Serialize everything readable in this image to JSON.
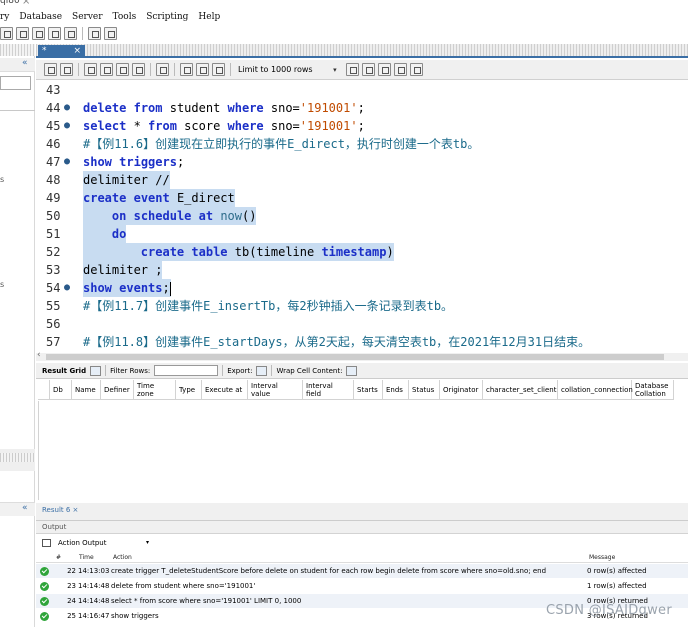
{
  "window": {
    "title_fragment": "ql80",
    "close_glyph": "×"
  },
  "menu": [
    "ry",
    "Database",
    "Server",
    "Tools",
    "Scripting",
    "Help"
  ],
  "editor_tab": {
    "label": "*",
    "close_glyph": "×"
  },
  "editor_toolbar": {
    "limit_label": "Limit to 1000 rows",
    "limit_dropdown": "▾"
  },
  "left_panel": {
    "chevron": "«",
    "tick_s": "s",
    "chevron_bottom": "«"
  },
  "code_lines": [
    {
      "n": "43",
      "dot": false,
      "html": ""
    },
    {
      "n": "44",
      "dot": true,
      "html": "<span class=\"kw\">delete</span> <span class=\"kw\">from</span> student <span class=\"kw\">where</span> sno=<span class=\"str\">'191001'</span>;"
    },
    {
      "n": "45",
      "dot": true,
      "html": "<span class=\"kw\">select</span> * <span class=\"kw\">from</span> score <span class=\"kw\">where</span> sno=<span class=\"str\">'191001'</span>;"
    },
    {
      "n": "46",
      "dot": false,
      "html": "<span class=\"cm\">#【例11.6】创建现在立即执行的事件E_direct，执行时创建一个表tb。</span>"
    },
    {
      "n": "47",
      "dot": true,
      "html": "<span class=\"kw\">show</span> <span class=\"kw\">triggers</span>;"
    },
    {
      "n": "48",
      "dot": false,
      "sel": true,
      "html": "delimiter //"
    },
    {
      "n": "49",
      "dot": false,
      "sel": true,
      "html": "<span class=\"kw\">create</span> <span class=\"kw\">event</span> E_direct"
    },
    {
      "n": "50",
      "dot": false,
      "sel": true,
      "html": "    <span class=\"kw\">on</span> <span class=\"kw\">schedule</span> <span class=\"kw\">at</span> <span class=\"fn\">now</span>()"
    },
    {
      "n": "51",
      "dot": false,
      "sel": true,
      "html": "    <span class=\"kw\">do</span>"
    },
    {
      "n": "52",
      "dot": false,
      "sel": true,
      "html": "        <span class=\"kw\">create</span> <span class=\"kw\">table</span> tb(timeline <span class=\"kw\">timestamp</span>)"
    },
    {
      "n": "53",
      "dot": false,
      "sel": true,
      "html": "delimiter ;"
    },
    {
      "n": "54",
      "dot": true,
      "sel": true,
      "caret": true,
      "html": "<span class=\"kw\">show</span> <span class=\"kw\">events</span>;"
    },
    {
      "n": "55",
      "dot": false,
      "html": "<span class=\"cm\">#【例11.7】创建事件E_insertTb，每2秒钟插入一条记录到表tb。</span>"
    },
    {
      "n": "56",
      "dot": false,
      "html": ""
    },
    {
      "n": "57",
      "dot": false,
      "html": "<span class=\"cm\">#【例11.8】创建事件E_startDays，从第2天起，每天清空表tb，在2021年12月31日结束。</span>"
    }
  ],
  "result_toolbar": {
    "result_grid": "Result Grid",
    "filter_rows": "Filter Rows:",
    "export": "Export:",
    "wrap": "Wrap Cell Content:"
  },
  "grid_columns": [
    {
      "label": "Db",
      "w": 22
    },
    {
      "label": "Name",
      "w": 29
    },
    {
      "label": "Definer",
      "w": 33
    },
    {
      "label": "Time zone",
      "w": 42
    },
    {
      "label": "Type",
      "w": 26
    },
    {
      "label": "Execute at",
      "w": 46
    },
    {
      "label": "Interval value",
      "w": 55
    },
    {
      "label": "Interval field",
      "w": 51
    },
    {
      "label": "Starts",
      "w": 29
    },
    {
      "label": "Ends",
      "w": 26
    },
    {
      "label": "Status",
      "w": 31
    },
    {
      "label": "Originator",
      "w": 43
    },
    {
      "label": "character_set_client",
      "w": 75
    },
    {
      "label": "collation_connection",
      "w": 74
    },
    {
      "label": "Database Collation",
      "w": 42
    }
  ],
  "result_tab": "Result 6 ×",
  "output": {
    "header": "Output",
    "mode": "Action Output",
    "mode_dd": "▾",
    "cols": {
      "hash": "#",
      "time": "Time",
      "action": "Action",
      "message": "Message"
    },
    "rows": [
      {
        "n": "22",
        "time": "14:13:03",
        "action": "create trigger T_deleteStudentScore before delete on student for each row    begin delete from score where sno=old.sno;    end",
        "msg": "0 row(s) affected"
      },
      {
        "n": "23",
        "time": "14:14:48",
        "action": "delete from student where sno='191001'",
        "msg": "1 row(s) affected"
      },
      {
        "n": "24",
        "time": "14:14:48",
        "action": "select * from score where sno='191001' LIMIT 0, 1000",
        "msg": "0 row(s) returned"
      },
      {
        "n": "25",
        "time": "14:16:47",
        "action": "show triggers",
        "msg": "3 row(s) returned"
      }
    ]
  },
  "watermark": "CSDN @ISAIDqwer"
}
